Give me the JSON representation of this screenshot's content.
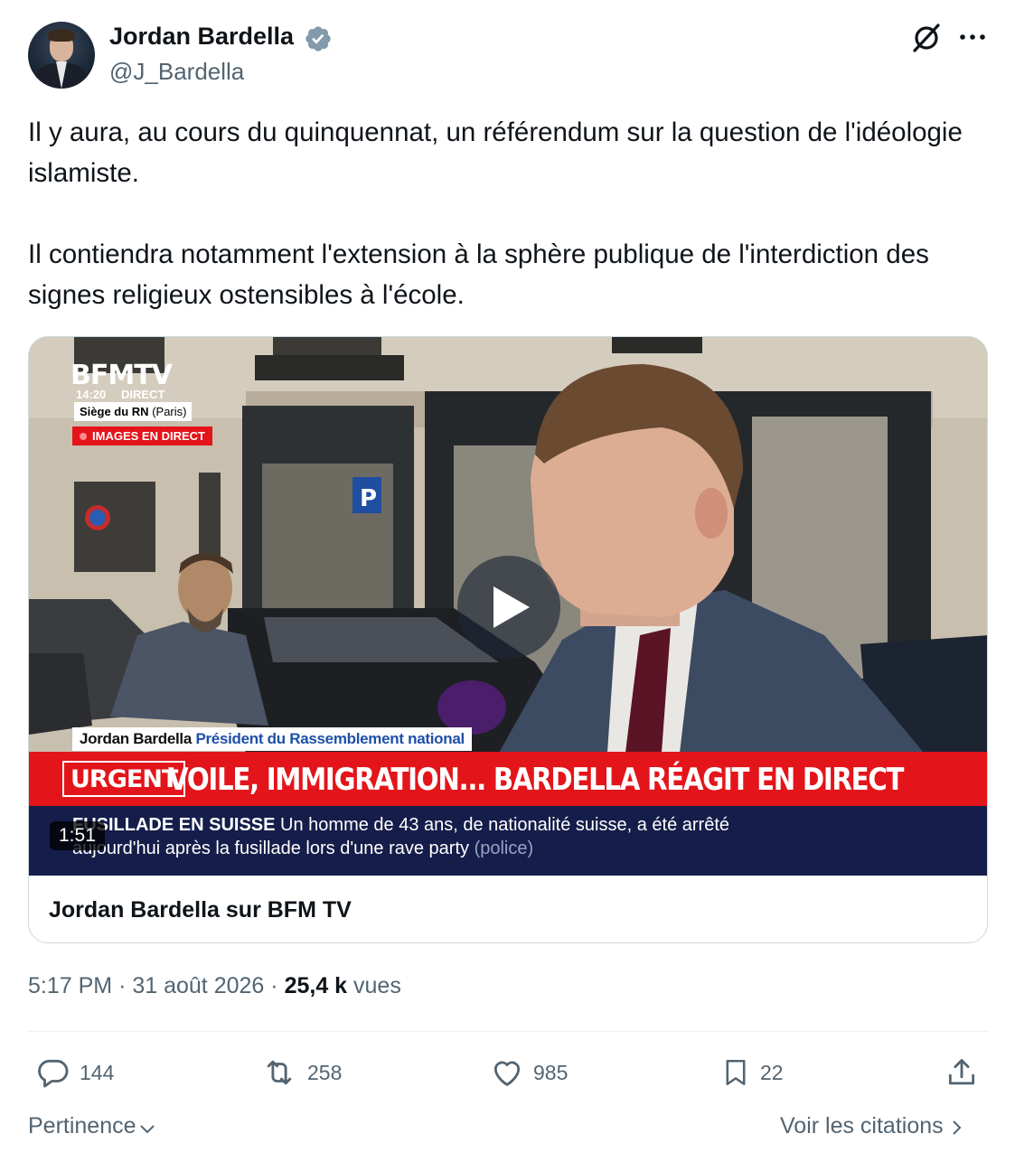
{
  "author": {
    "name": "Jordan Bardella",
    "handle": "@J_Bardella",
    "verified": true,
    "verified_color": "#829aab"
  },
  "icons": {
    "grok": "grok-icon",
    "more": "more-icon",
    "reply": "reply-icon",
    "retweet": "retweet-icon",
    "like": "heart-icon",
    "bookmark": "bookmark-icon",
    "share": "share-icon"
  },
  "tweet": {
    "paragraph1": "Il y aura, au cours du quinquennat, un référendum sur la question de l'idéologie islamiste.",
    "paragraph2": "Il contiendra notamment l'extension à la sphère publique de l'interdiction des signes religieux ostensibles à l'école."
  },
  "card": {
    "title": "Jordan Bardella sur BFM TV",
    "duration": "1:51",
    "broadcast": {
      "logo": "BFMTV",
      "time": "14:20",
      "direct": "DIRECT",
      "location": "Siège du RN",
      "location_sub": "(Paris)",
      "live_tag": "IMAGES EN DIRECT",
      "lower_name": "Jordan Bardella",
      "lower_role": "Président du Rassemblement national",
      "urgent_tag": "URGENT",
      "headline": "VOILE, IMMIGRATION... BARDELLA RÉAGIT EN DIRECT",
      "ticker_bold": "FUSILLADE EN SUISSE",
      "ticker_line1": "Un homme de 43 ans, de nationalité suisse, a été arrêté",
      "ticker_line2": "aujourd'hui après la fusillade lors d'une rave party",
      "ticker_source": "(police)"
    }
  },
  "meta": {
    "time": "5:17 PM",
    "separator": "·",
    "date": "31 août 2026",
    "views_count": "25,4 k",
    "views_label": "vues"
  },
  "actions": {
    "replies": "144",
    "retweets": "258",
    "likes": "985",
    "bookmarks": "22"
  },
  "footer": {
    "sort_label": "Pertinence",
    "quotes_label": "Voir les citations"
  },
  "colors": {
    "text_primary": "#0f1419",
    "text_secondary": "#536471",
    "border": "#cfd9de",
    "bfm_red": "#e3151a",
    "bfm_navy": "#151d4a"
  }
}
